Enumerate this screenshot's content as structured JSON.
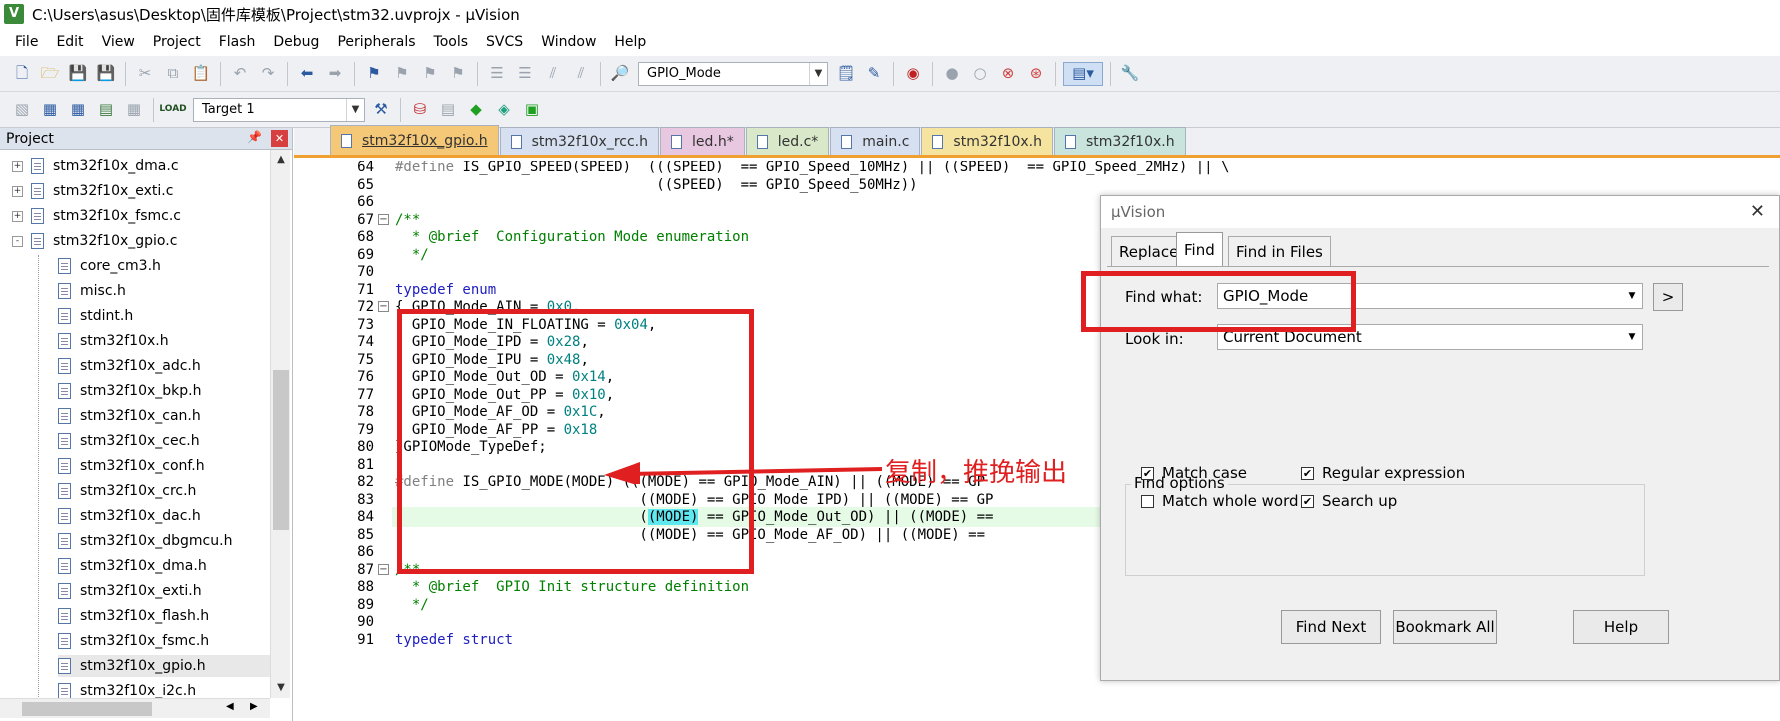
{
  "window": {
    "title": "C:\\Users\\asus\\Desktop\\固件库模板\\Project\\stm32.uvprojx - µVision"
  },
  "menu": [
    "File",
    "Edit",
    "View",
    "Project",
    "Flash",
    "Debug",
    "Peripherals",
    "Tools",
    "SVCS",
    "Window",
    "Help"
  ],
  "toolbar1": {
    "find_combo_value": "GPIO_Mode"
  },
  "toolbar2": {
    "target_combo_value": "Target 1"
  },
  "project_panel": {
    "title": "Project",
    "items": [
      {
        "label": "stm32f10x_dma.c",
        "level": 1,
        "expander": "+"
      },
      {
        "label": "stm32f10x_exti.c",
        "level": 1,
        "expander": "+"
      },
      {
        "label": "stm32f10x_fsmc.c",
        "level": 1,
        "expander": "+"
      },
      {
        "label": "stm32f10x_gpio.c",
        "level": 1,
        "expander": "-"
      },
      {
        "label": "core_cm3.h",
        "level": 2
      },
      {
        "label": "misc.h",
        "level": 2
      },
      {
        "label": "stdint.h",
        "level": 2
      },
      {
        "label": "stm32f10x.h",
        "level": 2
      },
      {
        "label": "stm32f10x_adc.h",
        "level": 2
      },
      {
        "label": "stm32f10x_bkp.h",
        "level": 2
      },
      {
        "label": "stm32f10x_can.h",
        "level": 2
      },
      {
        "label": "stm32f10x_cec.h",
        "level": 2
      },
      {
        "label": "stm32f10x_conf.h",
        "level": 2
      },
      {
        "label": "stm32f10x_crc.h",
        "level": 2
      },
      {
        "label": "stm32f10x_dac.h",
        "level": 2
      },
      {
        "label": "stm32f10x_dbgmcu.h",
        "level": 2
      },
      {
        "label": "stm32f10x_dma.h",
        "level": 2
      },
      {
        "label": "stm32f10x_exti.h",
        "level": 2
      },
      {
        "label": "stm32f10x_flash.h",
        "level": 2
      },
      {
        "label": "stm32f10x_fsmc.h",
        "level": 2
      },
      {
        "label": "stm32f10x_gpio.h",
        "level": 2,
        "selected": true
      },
      {
        "label": "stm32f10x_i2c.h",
        "level": 2
      }
    ]
  },
  "tabs": [
    {
      "label": "stm32f10x_gpio.h",
      "color": "#f5c878",
      "active": true
    },
    {
      "label": "stm32f10x_rcc.h",
      "color": "#d6e0f0"
    },
    {
      "label": "led.h*",
      "color": "#e8c8e0"
    },
    {
      "label": "led.c*",
      "color": "#d8e8c8"
    },
    {
      "label": "main.c",
      "color": "#d6e0f0"
    },
    {
      "label": "stm32f10x.h",
      "color": "#f5e4a0"
    },
    {
      "label": "stm32f10x.h",
      "color": "#c8e4dc"
    }
  ],
  "editor": {
    "lines": [
      {
        "n": "64",
        "html": "<span class='pp'>#define</span> IS_GPIO_SPEED(SPEED)  (((SPEED)  == GPIO_Speed_10MHz) || ((SPEED)  == GPIO_Speed_2MHz) || \\"
      },
      {
        "n": "65",
        "html": "                               ((SPEED)  == GPIO_Speed_50MHz))"
      },
      {
        "n": "66",
        "html": ""
      },
      {
        "n": "67",
        "html": "<span class='cm'>/**</span>",
        "fold": "-"
      },
      {
        "n": "68",
        "html": "<span class='cm'>  * @brief  Configuration Mode enumeration</span>"
      },
      {
        "n": "69",
        "html": "<span class='cm'>  */</span>"
      },
      {
        "n": "70",
        "html": ""
      },
      {
        "n": "71",
        "html": "<span class='kw'>typedef enum</span>"
      },
      {
        "n": "72",
        "html": "{ GPIO_Mode_AIN = <span class='num'>0x0</span>,",
        "fold": "-"
      },
      {
        "n": "73",
        "html": "  GPIO_Mode_IN_FLOATING = <span class='num'>0x04</span>,"
      },
      {
        "n": "74",
        "html": "  GPIO_Mode_IPD = <span class='num'>0x28</span>,"
      },
      {
        "n": "75",
        "html": "  GPIO_Mode_IPU = <span class='num'>0x48</span>,"
      },
      {
        "n": "76",
        "html": "  GPIO_Mode_Out_OD = <span class='num'>0x14</span>,"
      },
      {
        "n": "77",
        "html": "  GPIO_Mode_Out_PP = <span class='num'>0x10</span>,"
      },
      {
        "n": "78",
        "html": "  GPIO_Mode_AF_OD = <span class='num'>0x1C</span>,"
      },
      {
        "n": "79",
        "html": "  GPIO_Mode_AF_PP = <span class='num'>0x18</span>"
      },
      {
        "n": "80",
        "html": "}GPIOMode_TypeDef;"
      },
      {
        "n": "81",
        "html": ""
      },
      {
        "n": "82",
        "html": "<span class='pp'>#define</span> IS_GPIO_MODE(MODE) (((MODE) == GPIO_Mode_AIN) || ((MODE) == GP"
      },
      {
        "n": "83",
        "html": "                             ((MODE) == GPIO_Mode_IPD) || ((MODE) == GP"
      },
      {
        "n": "84",
        "html": "                             (<span style='background:#60e8f0'>(MODE)</span> == GPIO_Mode_Out_OD) || ((MODE) =="
      },
      {
        "n": "85",
        "html": "                             ((MODE) == GPIO_Mode_AF_OD) || ((MODE) =="
      },
      {
        "n": "86",
        "html": ""
      },
      {
        "n": "87",
        "html": "<span class='cm'>/**</span>",
        "fold": "-"
      },
      {
        "n": "88",
        "html": "<span class='cm'>  * @brief  GPIO Init structure definition</span>"
      },
      {
        "n": "89",
        "html": "<span class='cm'>  */</span>"
      },
      {
        "n": "90",
        "html": ""
      },
      {
        "n": "91",
        "html": "<span class='kw'>typedef struct</span>"
      }
    ],
    "highlight_line": "84"
  },
  "annotation": {
    "text": "复制，推挽输出",
    "color": "#e02020"
  },
  "find_dialog": {
    "title": "µVision",
    "tabs": [
      "Replace",
      "Find",
      "Find in Files"
    ],
    "find_what_label": "Find what:",
    "find_what_value": "GPIO_Mode",
    "look_in_label": "Look in:",
    "look_in_value": "Current Document",
    "more_button": ">",
    "options_title": "Find options",
    "options": [
      {
        "label": "Match case",
        "checked": true
      },
      {
        "label": "Regular expression",
        "checked": true
      },
      {
        "label": "Match whole word",
        "checked": false
      },
      {
        "label": "Search up",
        "checked": true
      }
    ],
    "buttons": [
      "Find Next",
      "Bookmark All",
      "Help"
    ]
  }
}
